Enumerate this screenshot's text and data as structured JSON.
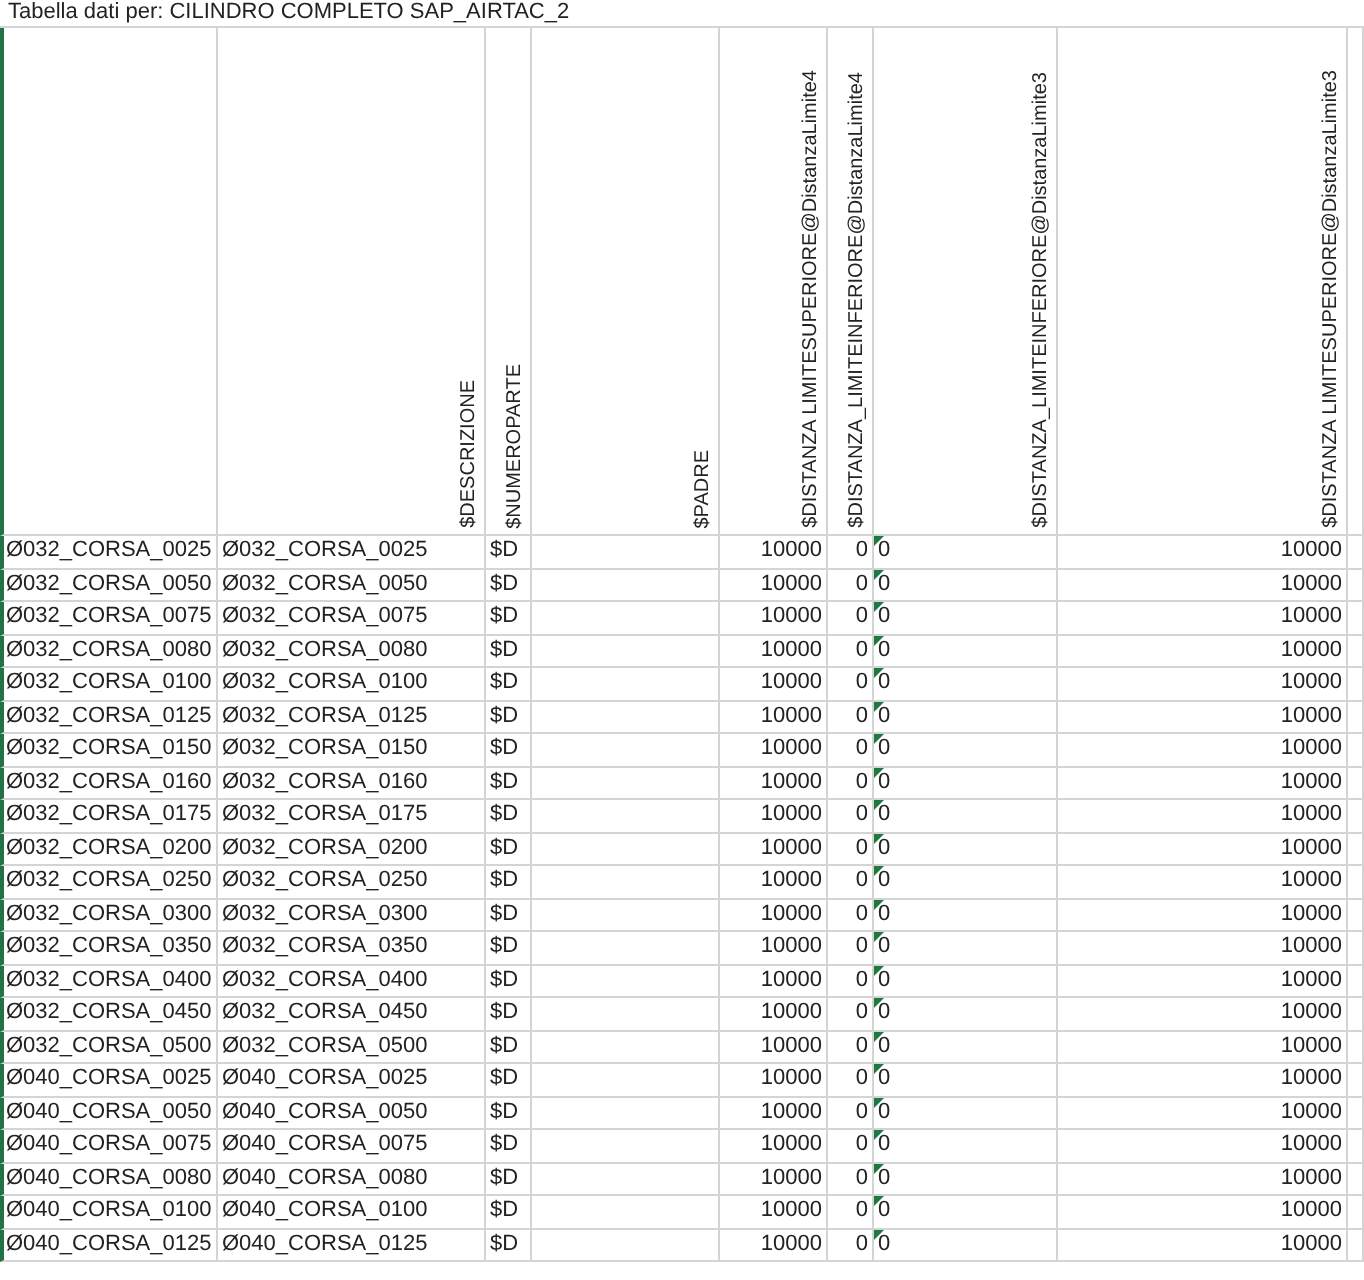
{
  "title": "Tabella dati per: CILINDRO COMPLETO SAP_AIRTAC_2",
  "columns": [
    {},
    {
      "header": "$DESCRIZIONE"
    },
    {
      "header": "$NUMEROPARTE"
    },
    {
      "header": "$PADRE"
    },
    {
      "header": "$DISTANZA LIMITESUPERIORE@DistanzaLimite4"
    },
    {
      "header": "$DISTANZA_LIMITEINFERIORE@DistanzaLimite4"
    },
    {
      "header": "$DISTANZA_LIMITEINFERIORE@DistanzaLimite3"
    },
    {
      "header": "$DISTANZA LIMITESUPERIORE@DistanzaLimite3"
    },
    {}
  ],
  "rows": [
    {
      "cells": [
        {
          "text": "Ø032_CORSA_0025",
          "kind": "text"
        },
        {
          "text": "Ø032_CORSA_0025",
          "kind": "text"
        },
        {
          "text": "$D",
          "kind": "text"
        },
        null,
        {
          "text": "10000",
          "kind": "number"
        },
        {
          "text": "0",
          "kind": "number"
        },
        {
          "text": "0",
          "kind": "text",
          "warning": true
        },
        {
          "text": "10000",
          "kind": "number"
        },
        null
      ]
    },
    {
      "cells": [
        {
          "text": "Ø032_CORSA_0050",
          "kind": "text"
        },
        {
          "text": "Ø032_CORSA_0050",
          "kind": "text"
        },
        {
          "text": "$D",
          "kind": "text"
        },
        null,
        {
          "text": "10000",
          "kind": "number"
        },
        {
          "text": "0",
          "kind": "number"
        },
        {
          "text": "0",
          "kind": "text",
          "warning": true
        },
        {
          "text": "10000",
          "kind": "number"
        },
        null
      ]
    },
    {
      "cells": [
        {
          "text": "Ø032_CORSA_0075",
          "kind": "text"
        },
        {
          "text": "Ø032_CORSA_0075",
          "kind": "text"
        },
        {
          "text": "$D",
          "kind": "text"
        },
        null,
        {
          "text": "10000",
          "kind": "number"
        },
        {
          "text": "0",
          "kind": "number"
        },
        {
          "text": "0",
          "kind": "text",
          "warning": true
        },
        {
          "text": "10000",
          "kind": "number"
        },
        null
      ]
    },
    {
      "cells": [
        {
          "text": "Ø032_CORSA_0080",
          "kind": "text"
        },
        {
          "text": "Ø032_CORSA_0080",
          "kind": "text"
        },
        {
          "text": "$D",
          "kind": "text"
        },
        null,
        {
          "text": "10000",
          "kind": "number"
        },
        {
          "text": "0",
          "kind": "number"
        },
        {
          "text": "0",
          "kind": "text",
          "warning": true
        },
        {
          "text": "10000",
          "kind": "number"
        },
        null
      ]
    },
    {
      "cells": [
        {
          "text": "Ø032_CORSA_0100",
          "kind": "text"
        },
        {
          "text": "Ø032_CORSA_0100",
          "kind": "text"
        },
        {
          "text": "$D",
          "kind": "text"
        },
        null,
        {
          "text": "10000",
          "kind": "number"
        },
        {
          "text": "0",
          "kind": "number"
        },
        {
          "text": "0",
          "kind": "text",
          "warning": true
        },
        {
          "text": "10000",
          "kind": "number"
        },
        null
      ]
    },
    {
      "cells": [
        {
          "text": "Ø032_CORSA_0125",
          "kind": "text"
        },
        {
          "text": "Ø032_CORSA_0125",
          "kind": "text"
        },
        {
          "text": "$D",
          "kind": "text"
        },
        null,
        {
          "text": "10000",
          "kind": "number"
        },
        {
          "text": "0",
          "kind": "number"
        },
        {
          "text": "0",
          "kind": "text",
          "warning": true
        },
        {
          "text": "10000",
          "kind": "number"
        },
        null
      ]
    },
    {
      "cells": [
        {
          "text": "Ø032_CORSA_0150",
          "kind": "text"
        },
        {
          "text": "Ø032_CORSA_0150",
          "kind": "text"
        },
        {
          "text": "$D",
          "kind": "text"
        },
        null,
        {
          "text": "10000",
          "kind": "number"
        },
        {
          "text": "0",
          "kind": "number"
        },
        {
          "text": "0",
          "kind": "text",
          "warning": true
        },
        {
          "text": "10000",
          "kind": "number"
        },
        null
      ]
    },
    {
      "cells": [
        {
          "text": "Ø032_CORSA_0160",
          "kind": "text"
        },
        {
          "text": "Ø032_CORSA_0160",
          "kind": "text"
        },
        {
          "text": "$D",
          "kind": "text"
        },
        null,
        {
          "text": "10000",
          "kind": "number"
        },
        {
          "text": "0",
          "kind": "number"
        },
        {
          "text": "0",
          "kind": "text",
          "warning": true
        },
        {
          "text": "10000",
          "kind": "number"
        },
        null
      ]
    },
    {
      "cells": [
        {
          "text": "Ø032_CORSA_0175",
          "kind": "text"
        },
        {
          "text": "Ø032_CORSA_0175",
          "kind": "text"
        },
        {
          "text": "$D",
          "kind": "text"
        },
        null,
        {
          "text": "10000",
          "kind": "number"
        },
        {
          "text": "0",
          "kind": "number"
        },
        {
          "text": "0",
          "kind": "text",
          "warning": true
        },
        {
          "text": "10000",
          "kind": "number"
        },
        null
      ]
    },
    {
      "cells": [
        {
          "text": "Ø032_CORSA_0200",
          "kind": "text"
        },
        {
          "text": "Ø032_CORSA_0200",
          "kind": "text"
        },
        {
          "text": "$D",
          "kind": "text"
        },
        null,
        {
          "text": "10000",
          "kind": "number"
        },
        {
          "text": "0",
          "kind": "number"
        },
        {
          "text": "0",
          "kind": "text",
          "warning": true
        },
        {
          "text": "10000",
          "kind": "number"
        },
        null
      ]
    },
    {
      "cells": [
        {
          "text": "Ø032_CORSA_0250",
          "kind": "text"
        },
        {
          "text": "Ø032_CORSA_0250",
          "kind": "text"
        },
        {
          "text": "$D",
          "kind": "text"
        },
        null,
        {
          "text": "10000",
          "kind": "number"
        },
        {
          "text": "0",
          "kind": "number"
        },
        {
          "text": "0",
          "kind": "text",
          "warning": true
        },
        {
          "text": "10000",
          "kind": "number"
        },
        null
      ]
    },
    {
      "cells": [
        {
          "text": "Ø032_CORSA_0300",
          "kind": "text"
        },
        {
          "text": "Ø032_CORSA_0300",
          "kind": "text"
        },
        {
          "text": "$D",
          "kind": "text"
        },
        null,
        {
          "text": "10000",
          "kind": "number"
        },
        {
          "text": "0",
          "kind": "number"
        },
        {
          "text": "0",
          "kind": "text",
          "warning": true
        },
        {
          "text": "10000",
          "kind": "number"
        },
        null
      ]
    },
    {
      "cells": [
        {
          "text": "Ø032_CORSA_0350",
          "kind": "text"
        },
        {
          "text": "Ø032_CORSA_0350",
          "kind": "text"
        },
        {
          "text": "$D",
          "kind": "text"
        },
        null,
        {
          "text": "10000",
          "kind": "number"
        },
        {
          "text": "0",
          "kind": "number"
        },
        {
          "text": "0",
          "kind": "text",
          "warning": true
        },
        {
          "text": "10000",
          "kind": "number"
        },
        null
      ]
    },
    {
      "cells": [
        {
          "text": "Ø032_CORSA_0400",
          "kind": "text"
        },
        {
          "text": "Ø032_CORSA_0400",
          "kind": "text"
        },
        {
          "text": "$D",
          "kind": "text"
        },
        null,
        {
          "text": "10000",
          "kind": "number"
        },
        {
          "text": "0",
          "kind": "number"
        },
        {
          "text": "0",
          "kind": "text",
          "warning": true
        },
        {
          "text": "10000",
          "kind": "number"
        },
        null
      ]
    },
    {
      "cells": [
        {
          "text": "Ø032_CORSA_0450",
          "kind": "text"
        },
        {
          "text": "Ø032_CORSA_0450",
          "kind": "text"
        },
        {
          "text": "$D",
          "kind": "text"
        },
        null,
        {
          "text": "10000",
          "kind": "number"
        },
        {
          "text": "0",
          "kind": "number"
        },
        {
          "text": "0",
          "kind": "text",
          "warning": true
        },
        {
          "text": "10000",
          "kind": "number"
        },
        null
      ]
    },
    {
      "cells": [
        {
          "text": "Ø032_CORSA_0500",
          "kind": "text"
        },
        {
          "text": "Ø032_CORSA_0500",
          "kind": "text"
        },
        {
          "text": "$D",
          "kind": "text"
        },
        null,
        {
          "text": "10000",
          "kind": "number"
        },
        {
          "text": "0",
          "kind": "number"
        },
        {
          "text": "0",
          "kind": "text",
          "warning": true
        },
        {
          "text": "10000",
          "kind": "number"
        },
        null
      ]
    },
    {
      "cells": [
        {
          "text": "Ø040_CORSA_0025",
          "kind": "text"
        },
        {
          "text": "Ø040_CORSA_0025",
          "kind": "text"
        },
        {
          "text": "$D",
          "kind": "text"
        },
        null,
        {
          "text": "10000",
          "kind": "number"
        },
        {
          "text": "0",
          "kind": "number"
        },
        {
          "text": "0",
          "kind": "text",
          "warning": true
        },
        {
          "text": "10000",
          "kind": "number"
        },
        null
      ]
    },
    {
      "cells": [
        {
          "text": "Ø040_CORSA_0050",
          "kind": "text"
        },
        {
          "text": "Ø040_CORSA_0050",
          "kind": "text"
        },
        {
          "text": "$D",
          "kind": "text"
        },
        null,
        {
          "text": "10000",
          "kind": "number"
        },
        {
          "text": "0",
          "kind": "number"
        },
        {
          "text": "0",
          "kind": "text",
          "warning": true
        },
        {
          "text": "10000",
          "kind": "number"
        },
        null
      ]
    },
    {
      "cells": [
        {
          "text": "Ø040_CORSA_0075",
          "kind": "text"
        },
        {
          "text": "Ø040_CORSA_0075",
          "kind": "text"
        },
        {
          "text": "$D",
          "kind": "text"
        },
        null,
        {
          "text": "10000",
          "kind": "number"
        },
        {
          "text": "0",
          "kind": "number"
        },
        {
          "text": "0",
          "kind": "text",
          "warning": true
        },
        {
          "text": "10000",
          "kind": "number"
        },
        null
      ]
    },
    {
      "cells": [
        {
          "text": "Ø040_CORSA_0080",
          "kind": "text"
        },
        {
          "text": "Ø040_CORSA_0080",
          "kind": "text"
        },
        {
          "text": "$D",
          "kind": "text"
        },
        null,
        {
          "text": "10000",
          "kind": "number"
        },
        {
          "text": "0",
          "kind": "number"
        },
        {
          "text": "0",
          "kind": "text",
          "warning": true
        },
        {
          "text": "10000",
          "kind": "number"
        },
        null
      ]
    },
    {
      "cells": [
        {
          "text": "Ø040_CORSA_0100",
          "kind": "text"
        },
        {
          "text": "Ø040_CORSA_0100",
          "kind": "text"
        },
        {
          "text": "$D",
          "kind": "text"
        },
        null,
        {
          "text": "10000",
          "kind": "number"
        },
        {
          "text": "0",
          "kind": "number"
        },
        {
          "text": "0",
          "kind": "text",
          "warning": true
        },
        {
          "text": "10000",
          "kind": "number"
        },
        null
      ]
    },
    {
      "cells": [
        {
          "text": "Ø040_CORSA_0125",
          "kind": "text"
        },
        {
          "text": "Ø040_CORSA_0125",
          "kind": "text"
        },
        {
          "text": "$D",
          "kind": "text"
        },
        null,
        {
          "text": "10000",
          "kind": "number"
        },
        {
          "text": "0",
          "kind": "number"
        },
        {
          "text": "0",
          "kind": "text",
          "warning": true
        },
        {
          "text": "10000",
          "kind": "number"
        },
        null
      ]
    }
  ]
}
